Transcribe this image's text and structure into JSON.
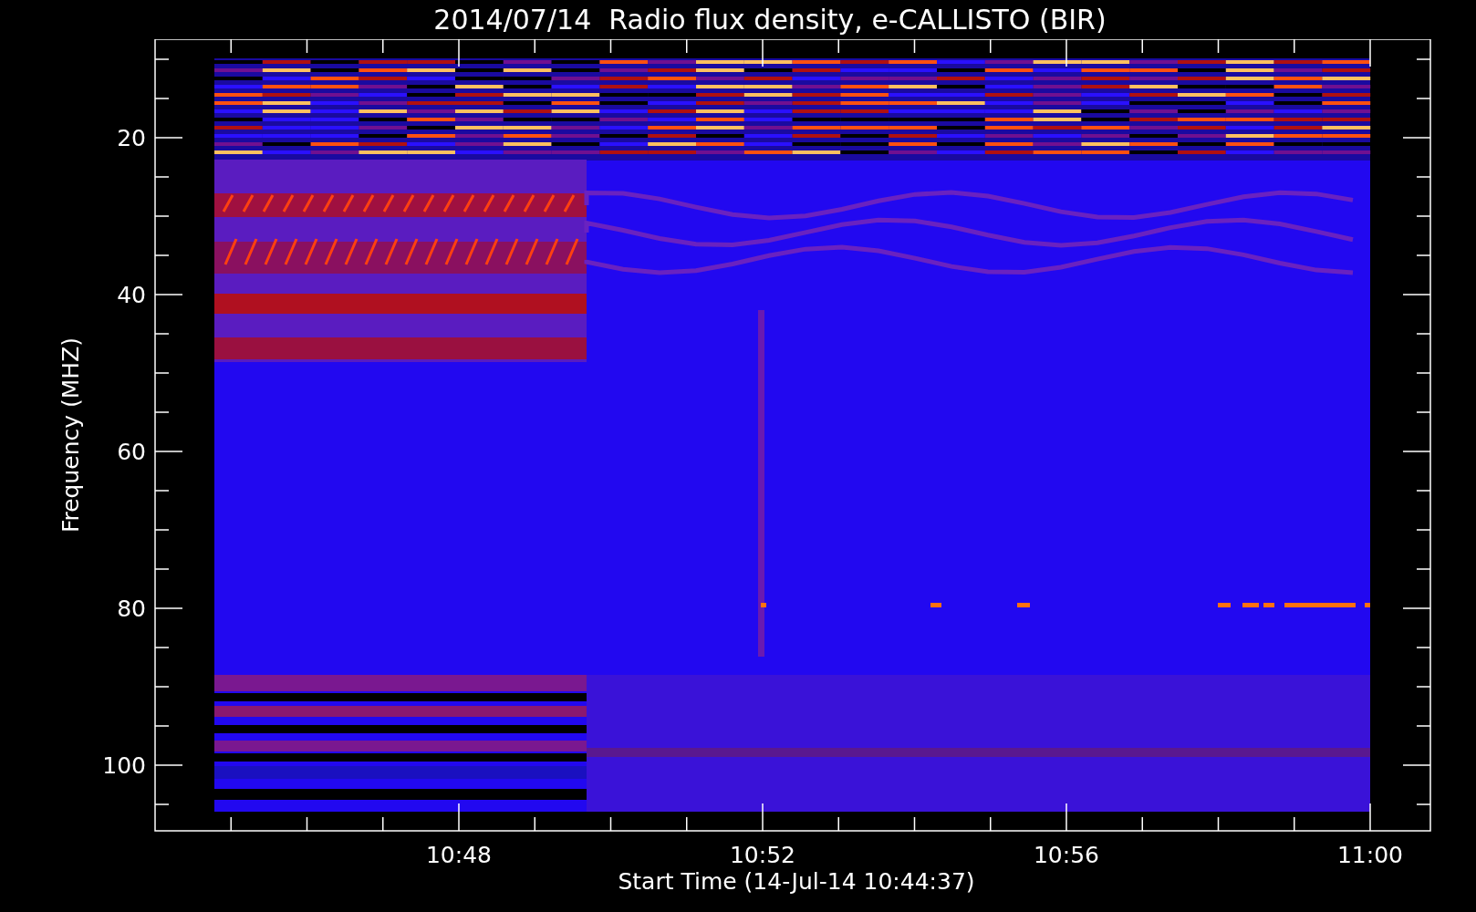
{
  "title": "2014/07/14  Radio flux density, e-CALLISTO (BIR)",
  "y_axis": {
    "label": "Frequency (MHZ)",
    "ticks": [
      "20",
      "40",
      "60",
      "80",
      "100"
    ]
  },
  "x_axis": {
    "label": "Start Time (14-Jul-14 10:44:37)",
    "ticks": [
      "10:48",
      "10:52",
      "10:56",
      "11:00"
    ]
  }
}
